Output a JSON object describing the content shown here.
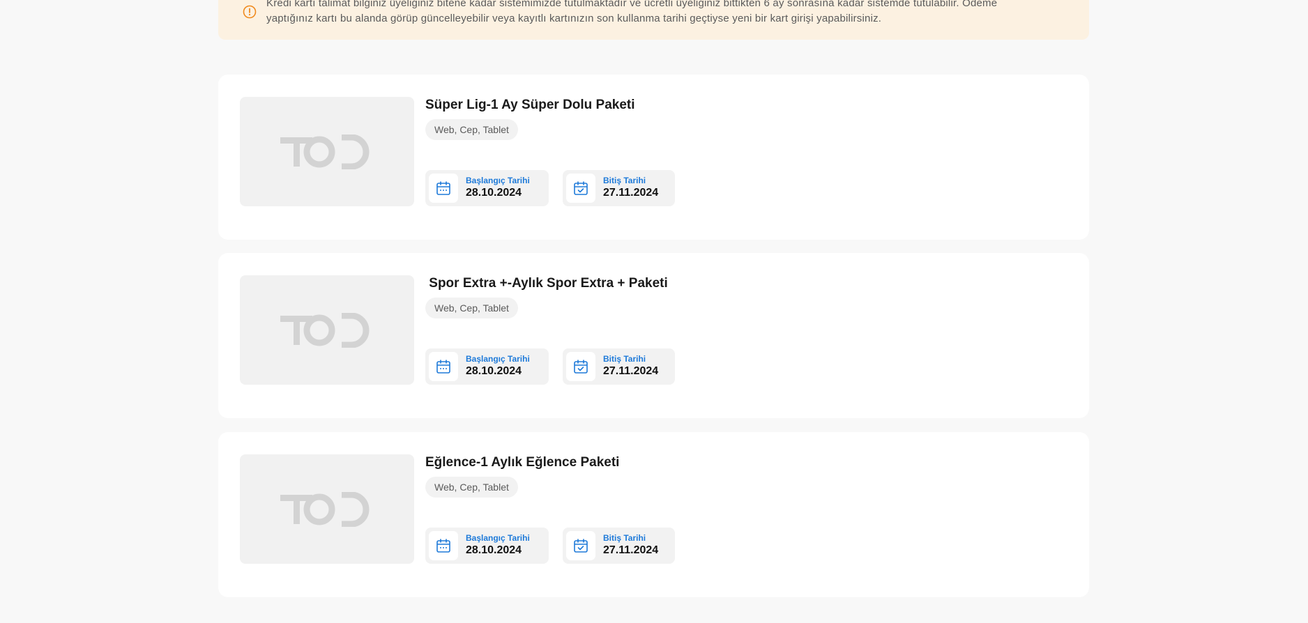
{
  "notice": {
    "icon": "warning-circle-icon",
    "line1": "Kredi kartı talimat bilginiz üyeliğiniz bitene kadar sistemimizde tutulmaktadır ve ücretli üyeliğiniz bittikten 6 ay sonrasına kadar sistemde tutulabilir. Ödeme",
    "line2": "yaptığınız kartı bu alanda görüp güncelleyebilir veya kayıtlı kartınızın son kullanma tarihi geçtiyse yeni bir kart girişi yapabilirsiniz.",
    "accent_color": "#f08a1d",
    "background_color": "#fcf1e1"
  },
  "packages": [
    {
      "title": "Süper Lig-1 Ay Süper Dolu Paketi",
      "platforms": "Web, Cep, Tablet",
      "thumbnail_logo": "TOD",
      "start_label": "Başlangıç Tarihi",
      "start_date": "28.10.2024",
      "end_label": "Bitiş Tarihi",
      "end_date": "27.11.2024"
    },
    {
      "title": " Spor Extra +-Aylık Spor Extra + Paketi",
      "platforms": "Web, Cep, Tablet",
      "thumbnail_logo": "TOD",
      "start_label": "Başlangıç Tarihi",
      "start_date": "28.10.2024",
      "end_label": "Bitiş Tarihi",
      "end_date": "27.11.2024"
    },
    {
      "title": "Eğlence-1 Aylık Eğlence Paketi",
      "platforms": "Web, Cep, Tablet",
      "thumbnail_logo": "TOD",
      "start_label": "Başlangıç Tarihi",
      "start_date": "28.10.2024",
      "end_label": "Bitiş Tarihi",
      "end_date": "27.11.2024"
    }
  ],
  "colors": {
    "date_label": "#1e7ad9",
    "calendar_icon": "#1e7ad9",
    "page_background": "#f8f8f8"
  },
  "icons": {
    "start_date": "calendar-icon",
    "end_date": "calendar-check-icon"
  }
}
